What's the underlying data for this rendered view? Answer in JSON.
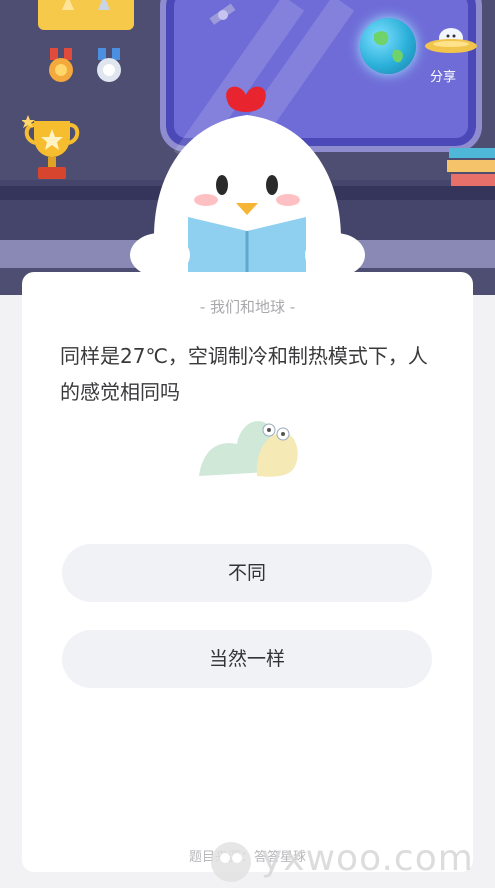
{
  "header": {
    "share_label": "分享"
  },
  "card": {
    "topic": "- 我们和地球 -",
    "question": "同样是27℃，空调制冷和制热模式下，人的感觉相同吗",
    "options": [
      {
        "label": "不同"
      },
      {
        "label": "当然一样"
      }
    ],
    "source": "题目来源：答答星球"
  },
  "watermark": {
    "text": "yxwoo.com"
  },
  "colors": {
    "header_bg": "#4e4d72",
    "window": "#6f6cd8",
    "trophy_gold": "#f7c94b",
    "chick_comb": "#e8242f",
    "book_blue": "#8fd0f0",
    "option_bg": "#f1f2f6",
    "snail_green": "#cfe8d8",
    "snail_yellow": "#f5e9b6"
  },
  "icons": [
    "trophy-icon",
    "medal-icon",
    "earth-icon",
    "ufo-icon",
    "books-icon",
    "chick-mascot",
    "snail-icon"
  ]
}
